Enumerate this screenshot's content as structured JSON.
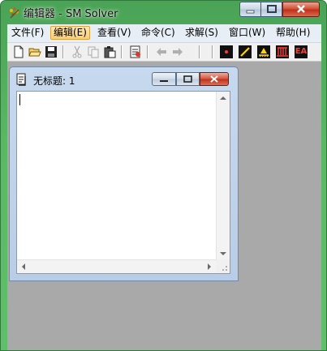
{
  "window": {
    "title": "编辑器 - SM Solver",
    "icon": "app-sparkle-icon",
    "colors": {
      "frame": "#58b864",
      "mdi_background": "#a9a9a9",
      "menu_active": "#f9cf78"
    }
  },
  "menu": {
    "items": [
      {
        "label": "文件(F)",
        "active": false
      },
      {
        "label": "编辑(E)",
        "active": true
      },
      {
        "label": "查看(V)",
        "active": false
      },
      {
        "label": "命令(C)",
        "active": false
      },
      {
        "label": "求解(S)",
        "active": false
      },
      {
        "label": "窗口(W)",
        "active": false
      },
      {
        "label": "帮助(H)",
        "active": false
      }
    ]
  },
  "toolbar": {
    "buttons": [
      {
        "icon": "new-file-icon",
        "enabled": true
      },
      {
        "icon": "open-folder-icon",
        "enabled": true
      },
      {
        "icon": "save-icon",
        "enabled": true
      },
      {
        "icon": "cut-icon",
        "enabled": false
      },
      {
        "icon": "copy-icon",
        "enabled": false
      },
      {
        "icon": "paste-icon",
        "enabled": true
      },
      {
        "icon": "solve-document-icon",
        "enabled": true
      },
      {
        "icon": "back-arrow-icon",
        "enabled": false
      },
      {
        "icon": "forward-arrow-icon",
        "enabled": false
      },
      {
        "icon": "red-point-icon",
        "enabled": true
      },
      {
        "icon": "yellow-line-icon",
        "enabled": true
      },
      {
        "icon": "support-icon",
        "enabled": true
      },
      {
        "icon": "distributed-load-icon",
        "enabled": true
      },
      {
        "icon": "ea-icon",
        "enabled": true,
        "text": "EA"
      }
    ]
  },
  "child_window": {
    "title": "无标题: 1",
    "icon": "document-icon",
    "content": ""
  }
}
